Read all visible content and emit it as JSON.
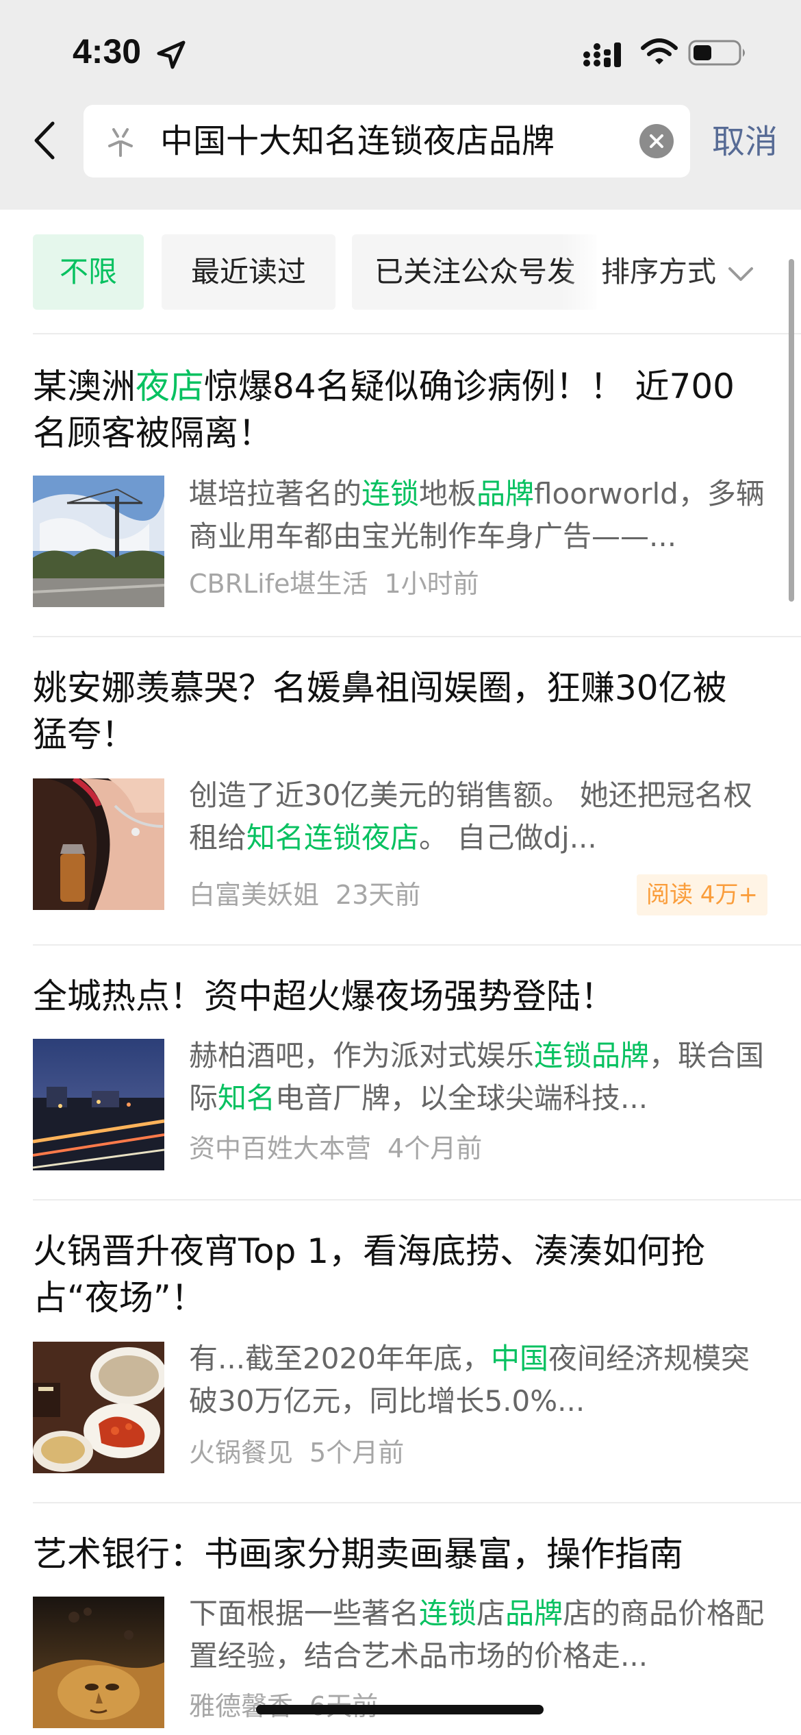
{
  "status_bar": {
    "time": "4:30"
  },
  "search": {
    "query": "中国十大知名连锁夜店品牌",
    "cancel_label": "取消"
  },
  "filters": {
    "chips": [
      "不限",
      "最近读过",
      "已关注公众号发"
    ],
    "sort_label": "排序方式"
  },
  "colors": {
    "accent": "#07c160",
    "link": "#576b95",
    "badge_text": "#fa9d3b",
    "badge_bg": "#fff4e5"
  },
  "results": [
    {
      "title": [
        {
          "t": "某澳洲"
        },
        {
          "t": "夜店",
          "hl": true
        },
        {
          "t": "惊爆84名疑似确诊病例！！ 近700名顾客被隔离！"
        }
      ],
      "snippet": [
        {
          "t": "堪培拉著名的"
        },
        {
          "t": "连锁",
          "hl": true
        },
        {
          "t": "地板"
        },
        {
          "t": "品牌",
          "hl": true
        },
        {
          "t": "floorworld，多辆商业用车都由宝光制作车身广告——..."
        }
      ],
      "source": "CBRLife堪生活",
      "time": "1小时前",
      "thumb": "crane-construction-photo"
    },
    {
      "title": [
        {
          "t": "姚安娜羡慕哭？名媛鼻祖闯娱圈，狂赚30亿被猛夸！"
        }
      ],
      "snippet": [
        {
          "t": "创造了近30亿美元的销售额。 她还把冠名权租给"
        },
        {
          "t": "知名连锁夜店",
          "hl": true
        },
        {
          "t": "。 自己做dj..."
        }
      ],
      "source": "白富美妖姐",
      "time": "23天前",
      "reads": "阅读 4万+",
      "thumb": "woman-with-drink-photo"
    },
    {
      "title": [
        {
          "t": "全城热点！资中超火爆夜场强势登陆！"
        }
      ],
      "snippet": [
        {
          "t": "赫柏酒吧，作为派对式娱乐"
        },
        {
          "t": "连锁品牌",
          "hl": true
        },
        {
          "t": "，联合国际"
        },
        {
          "t": "知名",
          "hl": true
        },
        {
          "t": "电音厂牌，以全球尖端科技..."
        }
      ],
      "source": "资中百姓大本营",
      "time": "4个月前",
      "thumb": "city-night-photo"
    },
    {
      "title": [
        {
          "t": "火锅晋升夜宵Top 1，看海底捞、湊湊如何抢占“夜场”！"
        }
      ],
      "snippet": [
        {
          "t": "有...截至2020年年底，"
        },
        {
          "t": "中国",
          "hl": true
        },
        {
          "t": "夜间经济规模突破30万亿元，同比增长5.0%..."
        }
      ],
      "source": "火锅餐见",
      "time": "5个月前",
      "thumb": "hotpot-food-photo"
    },
    {
      "title": [
        {
          "t": "艺术银行：书画家分期卖画暴富，操作指南"
        }
      ],
      "snippet": [
        {
          "t": "下面根据一些著名"
        },
        {
          "t": "连锁",
          "hl": true
        },
        {
          "t": "店"
        },
        {
          "t": "品牌",
          "hl": true
        },
        {
          "t": "店的商品价格配置经验，结合艺术品市场的价格走..."
        }
      ],
      "source": "雅德馨香",
      "time": "6天前",
      "thumb": "surreal-art-photo"
    }
  ]
}
